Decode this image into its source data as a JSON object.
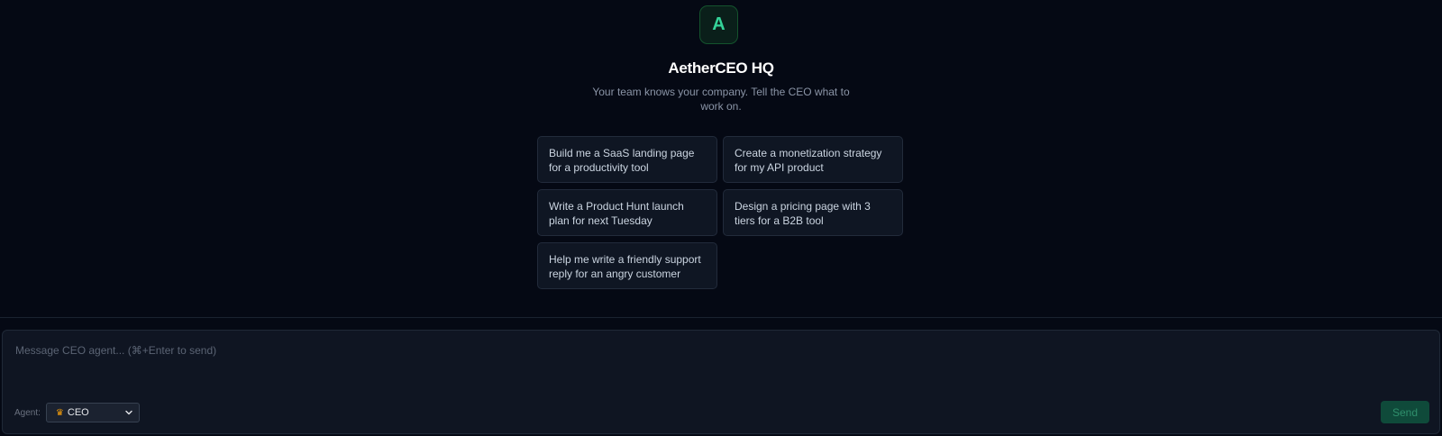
{
  "header": {
    "logo_letter": "A",
    "title": "AetherCEO HQ",
    "subtitle": "Your team knows your company. Tell the CEO what to work on."
  },
  "suggestions": [
    {
      "label": "Build me a SaaS landing page for a productivity tool"
    },
    {
      "label": "Create a monetization strategy for my API product"
    },
    {
      "label": "Write a Product Hunt launch plan for next Tuesday"
    },
    {
      "label": "Design a pricing page with 3 tiers for a B2B tool"
    },
    {
      "label": "Help me write a friendly support reply for an angry customer"
    }
  ],
  "composer": {
    "placeholder": "Message CEO agent... (⌘+Enter to send)",
    "value": "",
    "agent_label": "Agent:",
    "agent_selected": "CEO",
    "agent_icon": "crown-icon",
    "send_label": "Send"
  },
  "colors": {
    "background": "#050914",
    "accent": "#34d399",
    "send_button": "#0f4a3a"
  }
}
